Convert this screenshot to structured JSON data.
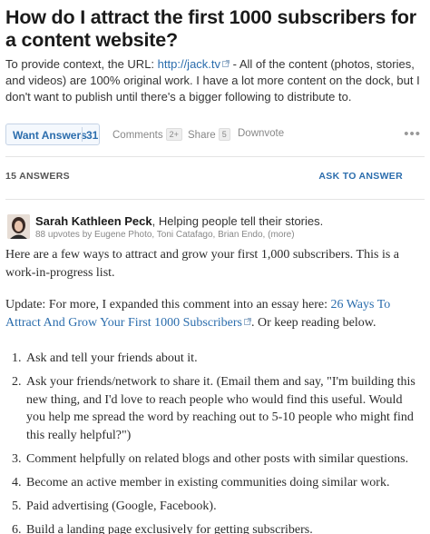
{
  "question": {
    "title": "How do I attract the first 1000 subscribers for a content website?",
    "details_prefix": "To provide context, the URL: ",
    "url": "http://jack.tv",
    "details_suffix": " - All of the content (photos, stories, and videos) are 100% original work. I have a lot more content on the dock, but I don't want to publish until there's a bigger following to distribute to."
  },
  "actions": {
    "want_answers_label": "Want Answers",
    "want_answers_count": "31",
    "comments_label": "Comments",
    "comments_count": "2+",
    "share_label": "Share",
    "share_count": "5",
    "downvote_label": "Downvote",
    "more_label": "•••"
  },
  "answers_header": {
    "count_label": "15 ANSWERS",
    "ask_label": "ASK TO ANSWER"
  },
  "answer": {
    "author_name": "Sarah Kathleen Peck",
    "author_bio": ", Helping people tell their stories.",
    "upvotes": "88 upvotes by Eugene Photo, Toni Catafago, Brian Endo, (more)",
    "intro": "Here are a few ways to attract and grow your first 1,000 subscribers. This is a work-in-progress list.",
    "update_prefix": "Update: For more, I expanded this comment into an essay here: ",
    "update_link": "26 Ways To Attract And Grow Your First 1000 Subscribers",
    "update_suffix": ". Or keep reading below.",
    "items": [
      {
        "num": "1.",
        "text": "Ask and tell your friends about it."
      },
      {
        "num": "2.",
        "text": "Ask your friends/network to share it. (Email them and say, \"I'm building this new thing, and I'd love to reach people who would find this useful. Would you help me spread the word by reaching out to 5-10 people who might find this really helpful?\")"
      },
      {
        "num": "3.",
        "text": "Comment helpfully on related blogs and other posts with similar questions."
      },
      {
        "num": "4.",
        "text": "Become an active member in existing communities doing similar work."
      },
      {
        "num": "5.",
        "text": "Paid advertising (Google, Facebook)."
      },
      {
        "num": "6.",
        "text": "Build a landing page exclusively for getting subscribers."
      }
    ]
  },
  "icons": {
    "external_link": "external-link-icon",
    "avatar": "author-avatar"
  },
  "colors": {
    "link": "#2b6dad",
    "title": "#1a1a1a",
    "muted": "#888888"
  }
}
